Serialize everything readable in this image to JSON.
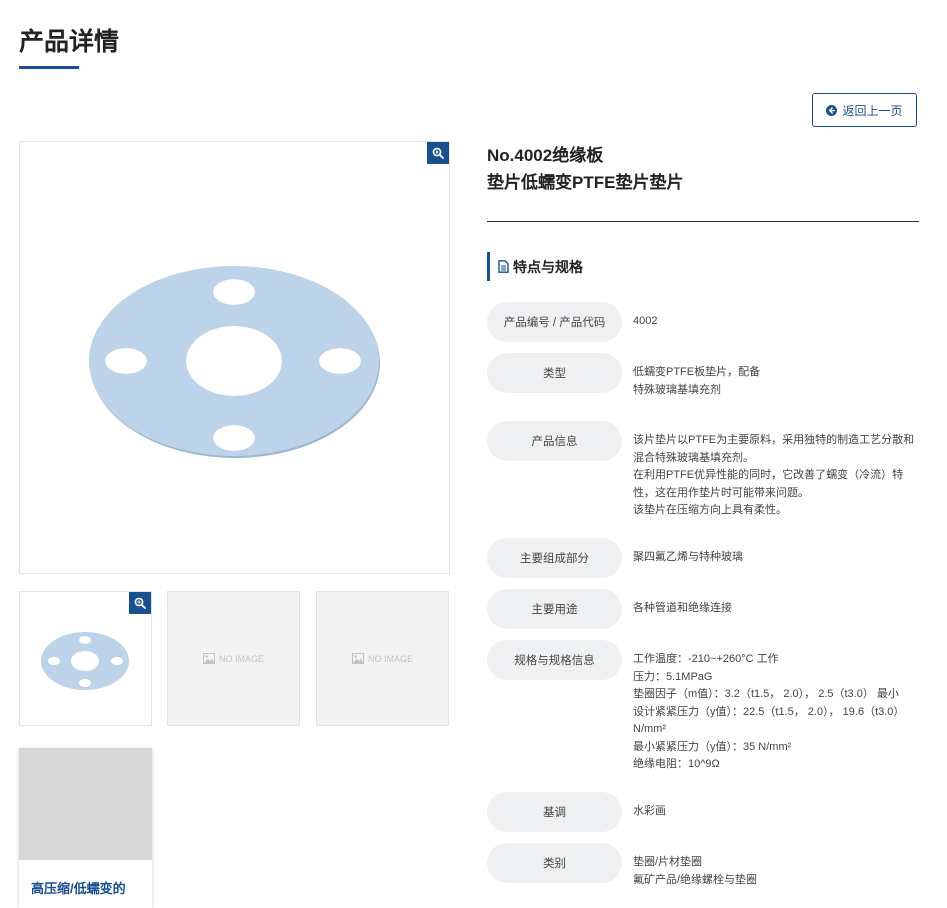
{
  "page": {
    "title": "产品详情"
  },
  "back_button": {
    "label": "返回上一页"
  },
  "gallery": {
    "no_image_label": "NO IMAGE"
  },
  "related": {
    "title": "高压缩/低蠕变的"
  },
  "product": {
    "title_line1": "No.4002绝缘板",
    "title_line2": "垫片低蠕变PTFE垫片垫片"
  },
  "section": {
    "title": "特点与规格"
  },
  "specs": [
    {
      "label": "产品编号 / 产品代码",
      "lines": [
        "4002"
      ]
    },
    {
      "label": "类型",
      "lines": [
        "低蠕变PTFE板垫片，配备",
        "特殊玻璃基填充剂"
      ]
    },
    {
      "label": "产品信息",
      "lines": [
        "该片垫片以PTFE为主要原料，采用独特的制造工艺分散和",
        "混合特殊玻璃基填充剂。",
        "在利用PTFE优异性能的同时，它改善了蠕变（冷流）特",
        "性，这在用作垫片时可能带来问题。",
        "该垫片在压缩方向上具有柔性。"
      ]
    },
    {
      "label": "主要组成部分",
      "lines": [
        "聚四氟乙烯与特种玻璃"
      ]
    },
    {
      "label": "主要用途",
      "lines": [
        "各种管道和绝缘连接"
      ]
    },
    {
      "label": "规格与规格信息",
      "lines": [
        "工作温度：-210~+260°C 工作",
        "压力：5.1MPaG",
        "垫圈因子（m值）：3.2（t1.5， 2.0）， 2.5（t3.0） 最小",
        "设计紧紧压力（y值）：22.5（t1.5， 2.0）， 19.6（t3.0）",
        "N/mm²",
        "最小紧紧压力（y值）：35 N/mm²",
        "绝缘电阻：10^9Ω"
      ]
    },
    {
      "label": "基调",
      "lines": [
        "水彩画"
      ]
    },
    {
      "label": "类别",
      "lines": [
        "垫圈/片材垫圈",
        "氟矿产品/绝缘螺栓与垫圈"
      ]
    }
  ],
  "colors": {
    "accent": "#1a4f8f",
    "gasket": "#bcd3ea",
    "label_bg": "#eef0f2"
  },
  "icons": {
    "zoom": "zoom-in-icon",
    "back": "arrow-left-circle-icon",
    "document": "document-icon",
    "no_image": "image-icon"
  }
}
